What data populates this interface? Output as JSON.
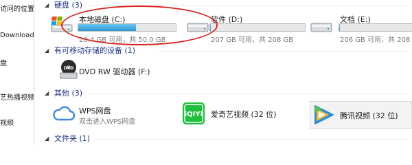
{
  "nav": {
    "items": [
      "访问的位置",
      "Downloads",
      "盘",
      "艺热播视频",
      "视频"
    ]
  },
  "groups": {
    "hard_disks": {
      "title": "硬盘 (3)"
    },
    "removable": {
      "title": "有可移动存储的设备 (1)"
    },
    "other": {
      "title": "其他 (3)"
    },
    "folders": {
      "title": "文件夹 (1)"
    }
  },
  "drives": [
    {
      "name": "本地磁盘 (C:)",
      "free_text": "20.4 GB 可用，共 50.0 GB",
      "used_fraction": 0.59,
      "bar_color": "#2a98d4"
    },
    {
      "name": "软件 (D:)",
      "free_text": "207 GB 可用，共 208 GB",
      "used_fraction": 0.01,
      "bar_color": "#2a98d4"
    },
    {
      "name": "文档 (E:)",
      "free_text": "206 GB 可用，共 208 GB",
      "used_fraction": 0.01,
      "bar_color": "#2a98d4"
    }
  ],
  "dvd": {
    "label": "DVD RW 驱动器 (F:)",
    "icon_text": "DVD"
  },
  "others": [
    {
      "name": "WPS网盘",
      "sub": "双击进入WPS网盘"
    },
    {
      "name": "爱奇艺视频 (32 位)",
      "icon_text": "iQIYI"
    },
    {
      "name": "腾讯视频 (32 位)"
    }
  ],
  "colors": {
    "group_header": "#1e3287",
    "highlight_ellipse": "#d7261e",
    "iqiyi_green": "#1dbf3a"
  }
}
